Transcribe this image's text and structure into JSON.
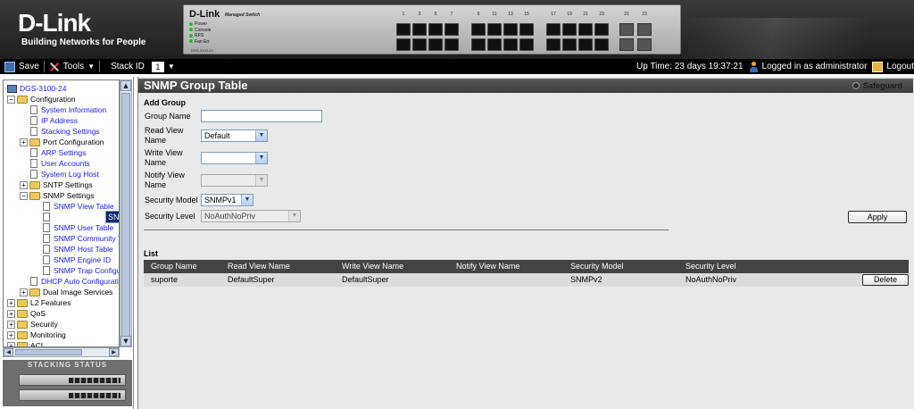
{
  "banner": {
    "logo": "D-Link",
    "tagline": "Building Networks for People",
    "device": {
      "brand": "D-Link",
      "model_label": "Managed Switch",
      "leds": [
        "Power",
        "Console",
        "RPS",
        "Fan Err"
      ],
      "serial": "DGS-3100-24",
      "port_numbers_a": [
        "1",
        "2",
        "3",
        "4",
        "5",
        "6",
        "7",
        "8"
      ],
      "port_numbers_b": [
        "9",
        "10",
        "11",
        "12",
        "13",
        "14",
        "15",
        "16"
      ],
      "port_numbers_c": [
        "17",
        "18",
        "19",
        "20",
        "21",
        "22",
        "23",
        "24"
      ],
      "port_numbers_d": [
        "21",
        "22",
        "23",
        "24"
      ]
    }
  },
  "toolbar": {
    "save": "Save",
    "tools": "Tools",
    "stack_id_label": "Stack ID",
    "stack_id_value": "1",
    "uptime": "Up Time: 23 days 19:37:21",
    "login": "Logged in as administrator",
    "logout": "Logout"
  },
  "tree": {
    "items": [
      {
        "label": "DGS-3100-24"
      },
      {
        "label": "Configuration"
      },
      {
        "label": "System Information"
      },
      {
        "label": "IP Address"
      },
      {
        "label": "Stacking Settings"
      },
      {
        "label": "Port Configuration"
      },
      {
        "label": "ARP Settings"
      },
      {
        "label": "User Accounts"
      },
      {
        "label": "System Log Host"
      },
      {
        "label": "SNTP Settings"
      },
      {
        "label": "SNMP Settings"
      },
      {
        "label": "SNMP View Table"
      },
      {
        "label": "SNMP Group Table"
      },
      {
        "label": "SNMP User Table"
      },
      {
        "label": "SNMP Community Ta"
      },
      {
        "label": "SNMP Host Table"
      },
      {
        "label": "SNMP Engine ID"
      },
      {
        "label": "SNMP Trap Configu"
      },
      {
        "label": "DHCP Auto Configuratic"
      },
      {
        "label": "Dual Image Services"
      },
      {
        "label": "L2 Features"
      },
      {
        "label": "QoS"
      },
      {
        "label": "Security"
      },
      {
        "label": "Monitoring"
      },
      {
        "label": "ACL"
      }
    ],
    "selected": "SNMP Group Table"
  },
  "stacking_status": {
    "title": "STACKING STATUS"
  },
  "page": {
    "title": "SNMP Group Table",
    "safeguard": "Safeguard"
  },
  "add_group": {
    "heading": "Add Group",
    "group_name_label": "Group Name",
    "group_name_value": "",
    "read_view_label": "Read View Name",
    "read_view_value": "Default",
    "write_view_label": "Write View Name",
    "write_view_value": "",
    "notify_view_label": "Notify View Name",
    "notify_view_value": "",
    "security_model_label": "Security Model",
    "security_model_value": "SNMPv1",
    "security_level_label": "Security Level",
    "security_level_value": "NoAuthNoPriv",
    "apply": "Apply"
  },
  "list": {
    "heading": "List",
    "columns": [
      "Group Name",
      "Read View Name",
      "Write View Name",
      "Notify View Name",
      "Security Model",
      "Security Level"
    ],
    "rows": [
      {
        "group_name": "suporte",
        "read_view": "DefaultSuper",
        "write_view": "DefaultSuper",
        "notify_view": "",
        "security_model": "SNMPv2",
        "security_level": "NoAuthNoPriv",
        "action": "Delete"
      }
    ]
  }
}
